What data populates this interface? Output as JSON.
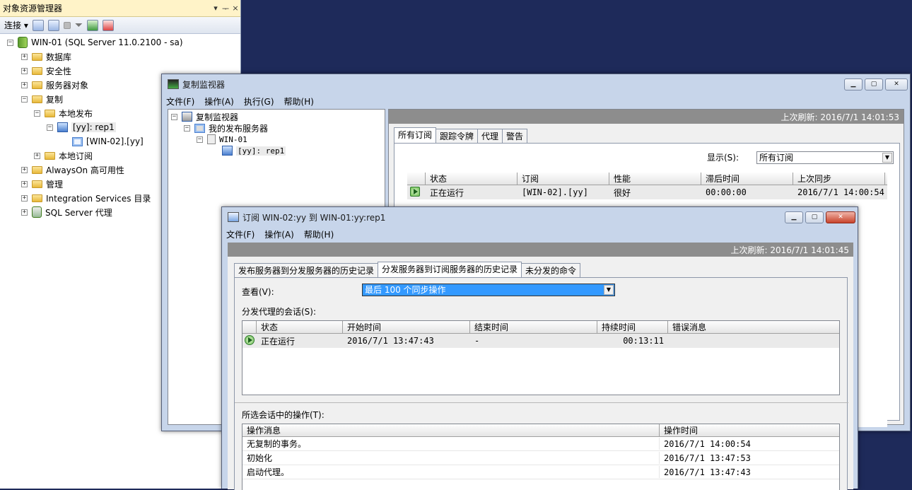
{
  "object_explorer": {
    "title": "对象资源管理器",
    "pin_glyph": "▾ 卩",
    "close_glyph": "×",
    "connect_label": "连接",
    "tree": {
      "server": "WIN-01 (SQL Server 11.0.2100 - sa)",
      "databases": "数据库",
      "security": "安全性",
      "server_objects": "服务器对象",
      "replication": "复制",
      "local_publications": "本地发布",
      "publication": "[yy]: rep1",
      "subscriber": "[WIN-02].[yy]",
      "local_subscriptions": "本地订阅",
      "alwayson": "AlwaysOn 高可用性",
      "management": "管理",
      "integration": "Integration Services 目录",
      "agent": "SQL Server 代理"
    }
  },
  "monitor": {
    "title": "复制监视器",
    "menu": [
      "文件(F)",
      "操作(A)",
      "执行(G)",
      "帮助(H)"
    ],
    "tree": {
      "root": "复制监视器",
      "my_publishers": "我的发布服务器",
      "publisher": "WIN-01",
      "publication": "[yy]: rep1"
    },
    "last_refresh": "上次刷新: 2016/7/1 14:01:53",
    "tabs": [
      "所有订阅",
      "跟踪令牌",
      "代理",
      "警告"
    ],
    "show_label": "显示(S):",
    "show_value": "所有订阅",
    "columns": [
      "状态",
      "订阅",
      "性能",
      "滞后时间",
      "上次同步"
    ],
    "row": {
      "status": "正在运行",
      "subscription": "[WIN-02].[yy]",
      "performance": "很好",
      "latency": "00:00:00",
      "last_sync": "2016/7/1 14:00:54"
    }
  },
  "subscription_window": {
    "title": "订阅 WIN-02:yy 到 WIN-01:yy:rep1",
    "menu": [
      "文件(F)",
      "操作(A)",
      "帮助(H)"
    ],
    "last_refresh": "上次刷新: 2016/7/1 14:01:45",
    "tabs": [
      "发布服务器到分发服务器的历史记录",
      "分发服务器到订阅服务器的历史记录",
      "未分发的命令"
    ],
    "view_label": "查看(V):",
    "view_value": "最后 100 个同步操作",
    "sessions_label": "分发代理的会话(S):",
    "session_columns": [
      "状态",
      "开始时间",
      "结束时间",
      "持续时间",
      "错误消息"
    ],
    "session_row": {
      "status": "正在运行",
      "start": "2016/7/1 13:47:43",
      "end": "-",
      "duration": "00:13:11",
      "error": ""
    },
    "actions_label": "所选会话中的操作(T):",
    "action_columns": [
      "操作消息",
      "操作时间"
    ],
    "actions": [
      {
        "message": "无复制的事务。",
        "time": "2016/7/1 14:00:54"
      },
      {
        "message": "初始化",
        "time": "2016/7/1 13:47:53"
      },
      {
        "message": "启动代理。",
        "time": "2016/7/1 13:47:43"
      }
    ]
  },
  "colors": {
    "desktop": "#1e2a5a",
    "window_frame": "#c7d5ea",
    "selection": "#3399ff",
    "refresh_band": "#8d8d8d"
  }
}
